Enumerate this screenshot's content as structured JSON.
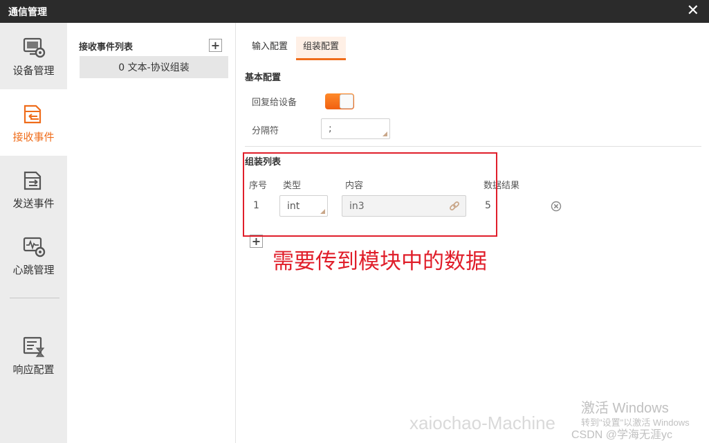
{
  "window": {
    "title": "通信管理",
    "close_glyph": "✕"
  },
  "nav": {
    "items": [
      {
        "label": "设备管理",
        "icon": "monitor-gear-icon"
      },
      {
        "label": "接收事件",
        "icon": "inbox-arrow-icon",
        "active": true
      },
      {
        "label": "发送事件",
        "icon": "send-arrow-icon"
      },
      {
        "label": "心跳管理",
        "icon": "heartbeat-gear-icon"
      },
      {
        "label": "响应配置",
        "icon": "list-hourglass-icon"
      }
    ]
  },
  "events": {
    "header": "接收事件列表",
    "add_label": "+",
    "items": [
      {
        "label": "0 文本-协议组装"
      }
    ]
  },
  "tabs": [
    {
      "label": "输入配置"
    },
    {
      "label": "组装配置",
      "active": true
    }
  ],
  "basic": {
    "title": "基本配置",
    "reply_label": "回复给设备",
    "reply_enabled": true,
    "separator_label": "分隔符",
    "separator_value": ";"
  },
  "assembly": {
    "title": "组装列表",
    "columns": {
      "index": "序号",
      "type": "类型",
      "content": "内容",
      "result": "数据结果"
    },
    "rows": [
      {
        "index": "1",
        "type": "int",
        "content": "in3",
        "result": "5"
      }
    ],
    "add_label": "+"
  },
  "annotation": "需要传到模块中的数据",
  "watermark": {
    "line1": "激活 Windows",
    "line2": "转到\"设置\"以激活 Windows",
    "csdn": "CSDN @学海无涯yc",
    "machine": "xaiochao-Machine"
  },
  "colors": {
    "accent": "#ef6c1a",
    "annotation": "#e01e2a",
    "titlebar": "#2b2b2b"
  }
}
